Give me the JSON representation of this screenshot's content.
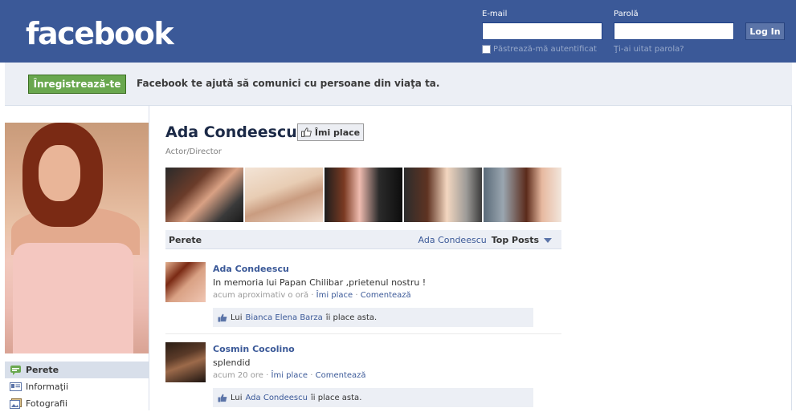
{
  "header": {
    "logo": "facebook",
    "email_label": "E-mail",
    "password_label": "Parolă",
    "login_button": "Log In",
    "remember_label": "Păstrează-mă autentificat",
    "forgot_link": "Ţi-ai uitat parola?"
  },
  "register_bar": {
    "button": "Înregistrează-te",
    "tagline": "Facebook te ajută să comunici cu persoane din viaţa ta."
  },
  "profile": {
    "name": "Ada Condeescu",
    "like_button": "Îmi place",
    "category": "Actor/Director"
  },
  "left_nav": [
    {
      "label": "Perete",
      "icon": "wall-icon",
      "active": true
    },
    {
      "label": "Informaţii",
      "icon": "info-icon",
      "active": false
    },
    {
      "label": "Fotografii",
      "icon": "photos-icon",
      "active": false
    }
  ],
  "wall": {
    "title": "Perete",
    "filter_owner": "Ada Condeescu",
    "filter_selected": "Top Posts"
  },
  "posts": [
    {
      "author": "Ada Condeescu",
      "text": "In memoria lui Papan Chilibar ,prietenul nostru !",
      "time": "acum aproximativ o oră",
      "like_link": "Îmi place",
      "comment_link": "Comentează",
      "likes_prefix": "Lui",
      "likes_name": "Bianca Elena Barza",
      "likes_suffix": "îi place asta."
    },
    {
      "author": "Cosmin Cocolino",
      "text": "splendid",
      "time": "acum 20 ore",
      "like_link": "Îmi place",
      "comment_link": "Comentează",
      "likes_prefix": "Lui",
      "likes_name": "Ada Condeescu",
      "likes_suffix": "îi place asta."
    }
  ],
  "colors": {
    "brand_blue": "#3b5998",
    "register_green": "#69a74e",
    "bar_gray": "#eceff5"
  }
}
